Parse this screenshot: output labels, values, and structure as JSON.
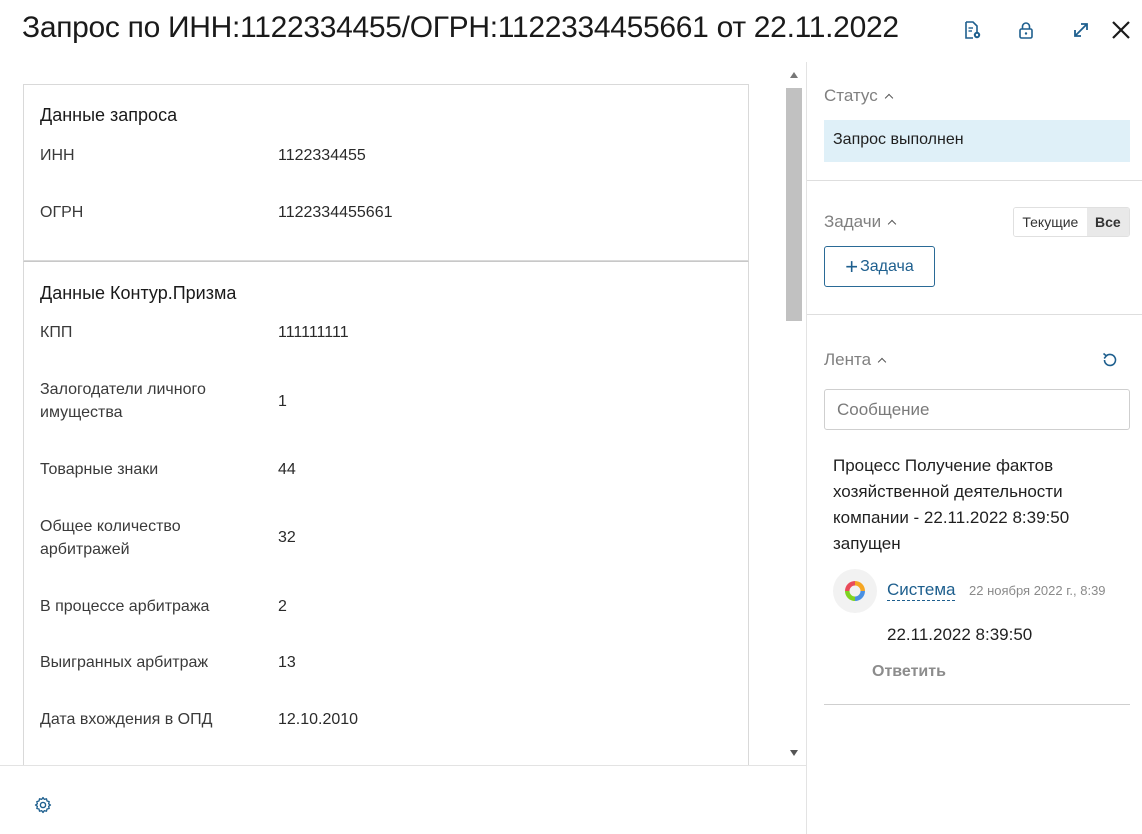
{
  "header": {
    "title": "Запрос по ИНН:1122334455/ОГРН:1122334455661 от 22.11.2022",
    "icons": [
      "document-settings-icon",
      "lock-icon",
      "expand-icon",
      "close-icon"
    ]
  },
  "request_card": {
    "title": "Данные запроса",
    "rows": [
      {
        "label": "ИНН",
        "value": "1122334455"
      },
      {
        "label": "ОГРН",
        "value": "1122334455661"
      }
    ]
  },
  "prizma_card": {
    "title": "Данные Контур.Призма",
    "rows": [
      {
        "label": "КПП",
        "value": "111111111"
      },
      {
        "label": "Залогодатели личного имущества",
        "value": "1"
      },
      {
        "label": "Товарные знаки",
        "value": "44"
      },
      {
        "label": "Общее количество арбитражей",
        "value": "32"
      },
      {
        "label": "В процессе арбитража",
        "value": "2"
      },
      {
        "label": "Выигранных арбитраж",
        "value": "13"
      },
      {
        "label": "Дата вхождения в ОПД",
        "value": "12.10.2010"
      }
    ]
  },
  "sidebar": {
    "status": {
      "title": "Статус",
      "value": "Запрос выполнен"
    },
    "tasks": {
      "title": "Задачи",
      "toggle_current": "Текущие",
      "toggle_all": "Все",
      "add_button": "Задача"
    },
    "feed": {
      "title": "Лента",
      "message_placeholder": "Сообщение",
      "item": {
        "text": "Процесс Получение фактов хозяйственной деятельности компании - 22.11.2022 8:39:50 запущен",
        "author": "Система",
        "time": "22 ноября 2022 г., 8:39",
        "body": "22.11.2022 8:39:50",
        "reply": "Ответить"
      }
    }
  },
  "colors": {
    "accent": "#1e5f8e",
    "status_bg": "#dff0f8"
  }
}
